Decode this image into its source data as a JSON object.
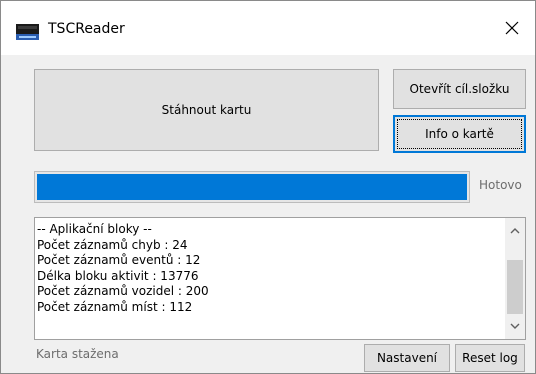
{
  "window": {
    "title": "TSCReader",
    "icon": "tacho-icon"
  },
  "buttons": {
    "download": "Stáhnout kartu",
    "open_folder": "Otevřít cíl.složku",
    "card_info": "Info o kartě",
    "settings": "Nastavení",
    "reset_log": "Reset log"
  },
  "progress": {
    "fraction": 1.0,
    "status": "Hotovo",
    "color": "#0078d7"
  },
  "log": {
    "lines": [
      "-- Aplikační bloky --",
      "Počet záznamů chyb : 24",
      "Počet záznamů eventů : 12",
      "Délka bloku aktivit : 13776",
      "Počet záznamů vozidel : 200",
      "Počet záznamů míst : 112"
    ]
  },
  "status": "Karta stažena"
}
